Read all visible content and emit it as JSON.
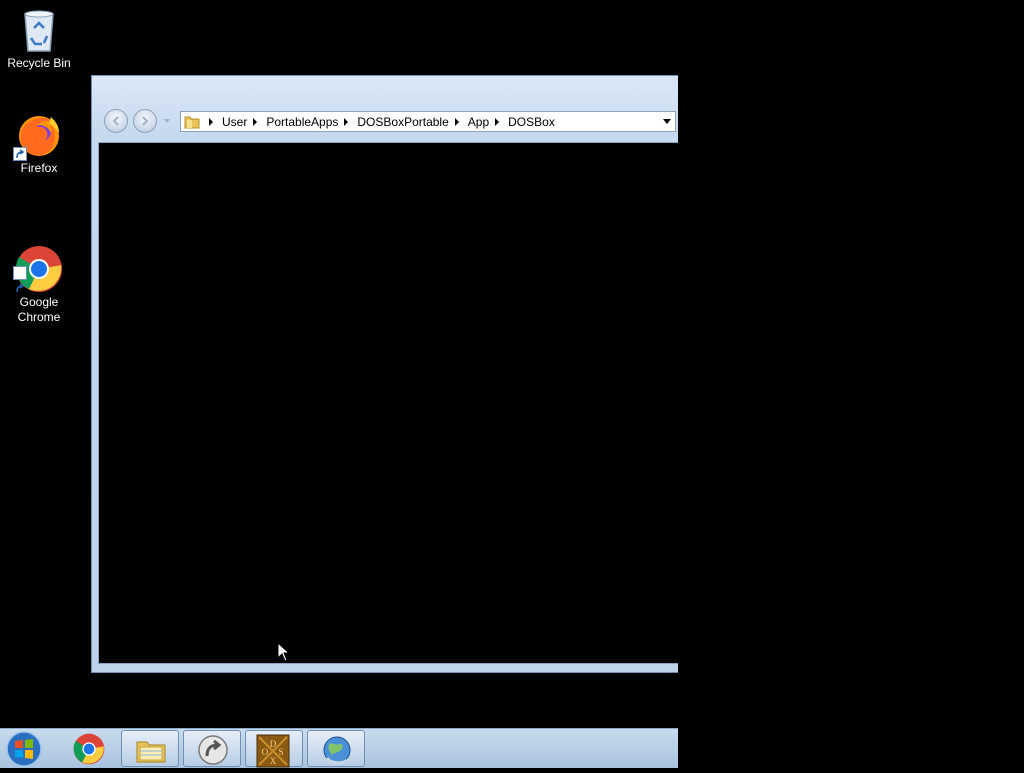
{
  "desktop": {
    "icons": [
      {
        "label": "Recycle Bin",
        "icon": "recycle-bin-icon"
      },
      {
        "label": "Firefox",
        "icon": "firefox-icon"
      },
      {
        "label": "Google\nChrome",
        "icon": "chrome-icon"
      }
    ]
  },
  "explorer": {
    "breadcrumbs": [
      "User",
      "PortableApps",
      "DOSBoxPortable",
      "App",
      "DOSBox"
    ]
  },
  "taskbar": {
    "items": [
      {
        "name": "start-button",
        "icon": "windows-logo-icon"
      },
      {
        "name": "chrome",
        "icon": "chrome-icon"
      },
      {
        "name": "file-explorer",
        "icon": "folder-icon"
      },
      {
        "name": "unknown-app",
        "icon": "arrow-circle-icon"
      },
      {
        "name": "dosbox",
        "icon": "dosbox-icon",
        "label": "DOS X"
      },
      {
        "name": "network",
        "icon": "globe-icon"
      }
    ]
  },
  "colors": {
    "desktop_background": "#000000",
    "window_frame": "#c6d9ee",
    "taskbar": "#b7cde4"
  }
}
